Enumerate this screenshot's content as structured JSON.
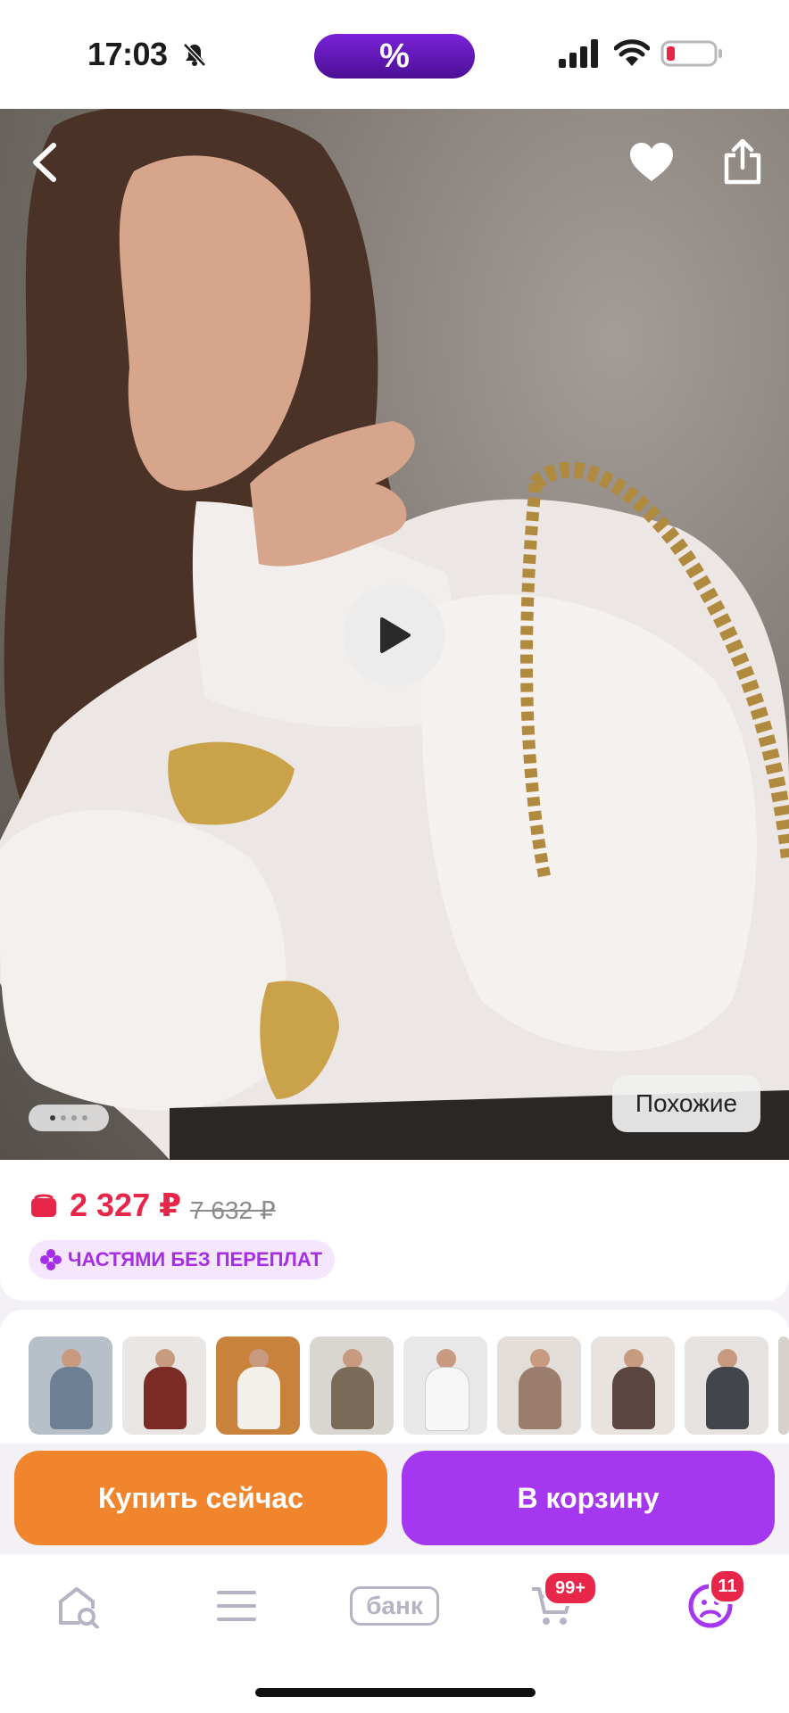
{
  "status_bar": {
    "time": "17:03",
    "promo_label": "%",
    "battery_color": "#e8264a"
  },
  "hero": {
    "icons": [
      "chevron-left-icon",
      "heart-icon",
      "share-icon",
      "play-icon"
    ],
    "image_count": 4,
    "active_image_index": 0,
    "similar_label": "Похожие"
  },
  "product": {
    "price": "2 327 ₽",
    "old_price": "7 632 ₽",
    "installments_label": "ЧАСТЯМИ БЕЗ ПЕРЕПЛАТ",
    "price_color": "#e8264a"
  },
  "thumbnails": [
    {
      "bg": "#b7c0c8",
      "outfit": "#6d7f93"
    },
    {
      "bg": "#e9e6e3",
      "outfit": "#7b2a26"
    },
    {
      "bg": "#c9823c",
      "outfit": "#f3efe9"
    },
    {
      "bg": "#d9d6d2",
      "outfit": "#7a6b58"
    },
    {
      "bg": "#e8e8e8",
      "outfit": "#f7f7f7"
    },
    {
      "bg": "#e2ddd8",
      "outfit": "#9a7d6b"
    },
    {
      "bg": "#e8e3de",
      "outfit": "#5b4540"
    },
    {
      "bg": "#e6e2df",
      "outfit": "#43454d"
    }
  ],
  "actions": {
    "buy_now_label": "Купить сейчас",
    "add_to_cart_label": "В корзину",
    "buy_now_color": "#f0852e",
    "add_to_cart_color": "#a537f0"
  },
  "bottom_nav": {
    "items": [
      "home-search-icon",
      "catalog-menu-icon",
      "bank-icon",
      "cart-icon",
      "profile-icon"
    ],
    "bank_label": "банк",
    "cart_badge": "99+",
    "profile_badge": "11"
  }
}
